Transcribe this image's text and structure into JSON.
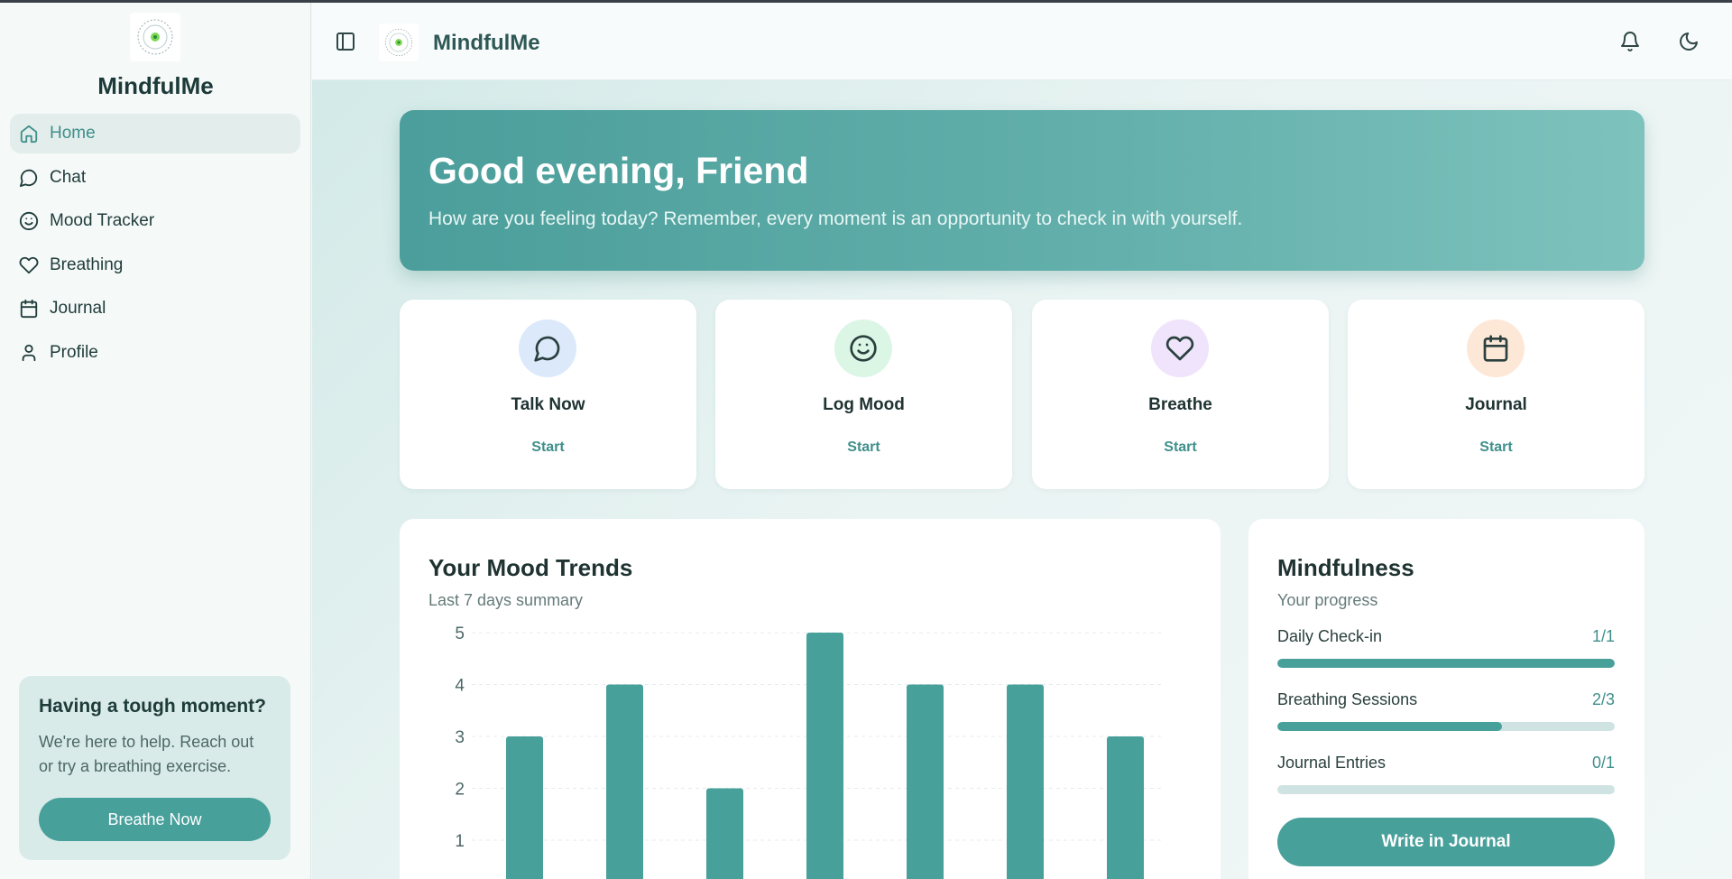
{
  "app": {
    "name": "MindfulMe"
  },
  "sidebar": {
    "title": "MindfulMe",
    "items": [
      {
        "label": "Home",
        "icon": "home-icon",
        "active": true
      },
      {
        "label": "Chat",
        "icon": "chat-icon"
      },
      {
        "label": "Mood Tracker",
        "icon": "smile-icon"
      },
      {
        "label": "Breathing",
        "icon": "heart-icon"
      },
      {
        "label": "Journal",
        "icon": "calendar-icon"
      },
      {
        "label": "Profile",
        "icon": "user-icon"
      }
    ],
    "help": {
      "title": "Having a tough moment?",
      "text": "We're here to help. Reach out or try a breathing exercise.",
      "button": "Breathe Now"
    }
  },
  "header": {
    "title": "MindfulMe"
  },
  "hero": {
    "title": "Good evening, Friend",
    "subtitle": "How are you feeling today? Remember, every moment is an opportunity to check in with yourself."
  },
  "actions": [
    {
      "label": "Talk Now",
      "start": "Start",
      "icon": "chat-icon",
      "tint": "#dbe9fb"
    },
    {
      "label": "Log Mood",
      "start": "Start",
      "icon": "smile-icon",
      "tint": "#dcf6e6"
    },
    {
      "label": "Breathe",
      "start": "Start",
      "icon": "heart-icon",
      "tint": "#efe4fb"
    },
    {
      "label": "Journal",
      "start": "Start",
      "icon": "calendar-icon",
      "tint": "#fde8d8"
    }
  ],
  "trends": {
    "title": "Your Mood Trends",
    "subtitle": "Last 7 days summary"
  },
  "chart_data": {
    "type": "bar",
    "title": "Your Mood Trends",
    "subtitle": "Last 7 days summary",
    "values": [
      3,
      4,
      2,
      5,
      4,
      4,
      3
    ],
    "yticks": [
      1,
      2,
      3,
      4,
      5
    ],
    "ylim": [
      0,
      5
    ],
    "grid": true,
    "color": "#48a09b"
  },
  "mindfulness": {
    "title": "Mindfulness",
    "subtitle": "Your progress",
    "items": [
      {
        "label": "Daily Check-in",
        "value": "1/1",
        "fraction": 1.0
      },
      {
        "label": "Breathing Sessions",
        "value": "2/3",
        "fraction": 0.667
      },
      {
        "label": "Journal Entries",
        "value": "0/1",
        "fraction": 0.0
      }
    ],
    "button": "Write in Journal"
  },
  "colors": {
    "accent": "#48a09b",
    "text": "#1d3b3a"
  }
}
